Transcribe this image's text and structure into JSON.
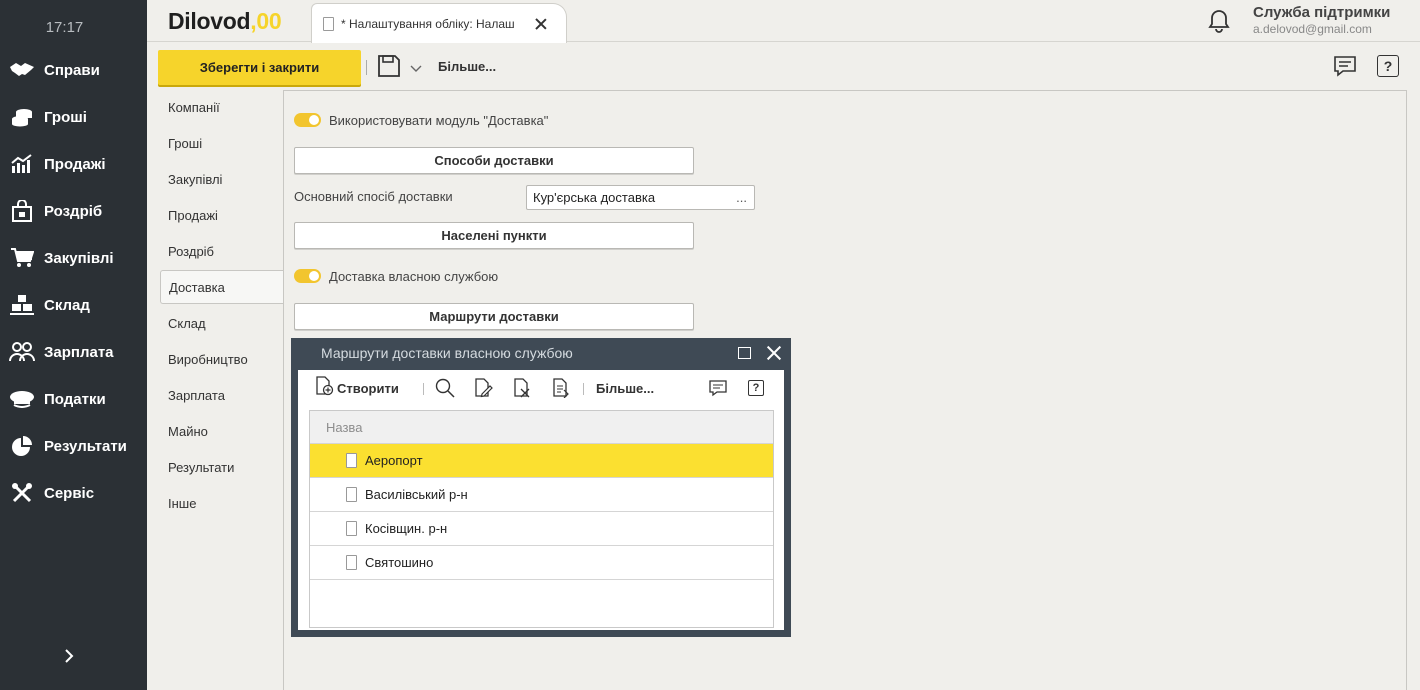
{
  "leftnav": {
    "clock": "17:17",
    "items": [
      {
        "label": "Справи",
        "icon": "handshake-icon"
      },
      {
        "label": "Гроші",
        "icon": "coins-icon"
      },
      {
        "label": "Продажі",
        "icon": "sales-chart-icon"
      },
      {
        "label": "Роздріб",
        "icon": "shopping-bag-icon"
      },
      {
        "label": "Закупівлі",
        "icon": "cart-icon"
      },
      {
        "label": "Склад",
        "icon": "boxes-icon"
      },
      {
        "label": "Зарплата",
        "icon": "people-icon"
      },
      {
        "label": "Податки",
        "icon": "officer-cap-icon"
      },
      {
        "label": "Результати",
        "icon": "pie-chart-icon"
      },
      {
        "label": "Сервіс",
        "icon": "tools-icon"
      }
    ]
  },
  "topbar": {
    "logo_text": "Dilovod",
    "logo_suffix": ",00",
    "tab_title": "* Налаштування обліку: Налаш",
    "support_title": "Служба підтримки",
    "support_email": "a.delovod@gmail.com"
  },
  "toolbar": {
    "save_close_label": "Зберегти і закрити",
    "more_label": "Більше..."
  },
  "settings_nav": {
    "items": [
      "Компанії",
      "Гроші",
      "Закупівлі",
      "Продажі",
      "Роздріб",
      "Доставка",
      "Склад",
      "Виробництво",
      "Зарплата",
      "Майно",
      "Результати",
      "Інше"
    ],
    "active": "Доставка"
  },
  "delivery": {
    "use_module_label": "Використовувати модуль \"Доставка\"",
    "use_module_on": true,
    "methods_button": "Способи доставки",
    "main_method_label": "Основний спосіб доставки",
    "main_method_value": "Кур'єрська доставка",
    "main_method_dots": "...",
    "localities_button": "Населені пункти",
    "own_service_label": "Доставка власною службою",
    "own_service_on": true,
    "routes_button": "Маршрути доставки"
  },
  "dialog": {
    "title": "Маршрути доставки власною службою",
    "create_label": "Створити",
    "more_label": "Більше...",
    "help_label": "?",
    "column_header": "Назва",
    "rows": [
      "Аеропорт",
      "Василівський р-н",
      "Косівщин. р-н",
      "Святошино"
    ],
    "selected_row": "Аеропорт"
  },
  "colors": {
    "nav_bg": "#2b3035",
    "accent_yellow": "#f6d42b",
    "selected_row": "#fbe030",
    "dialog_frame": "#3f4a55"
  }
}
